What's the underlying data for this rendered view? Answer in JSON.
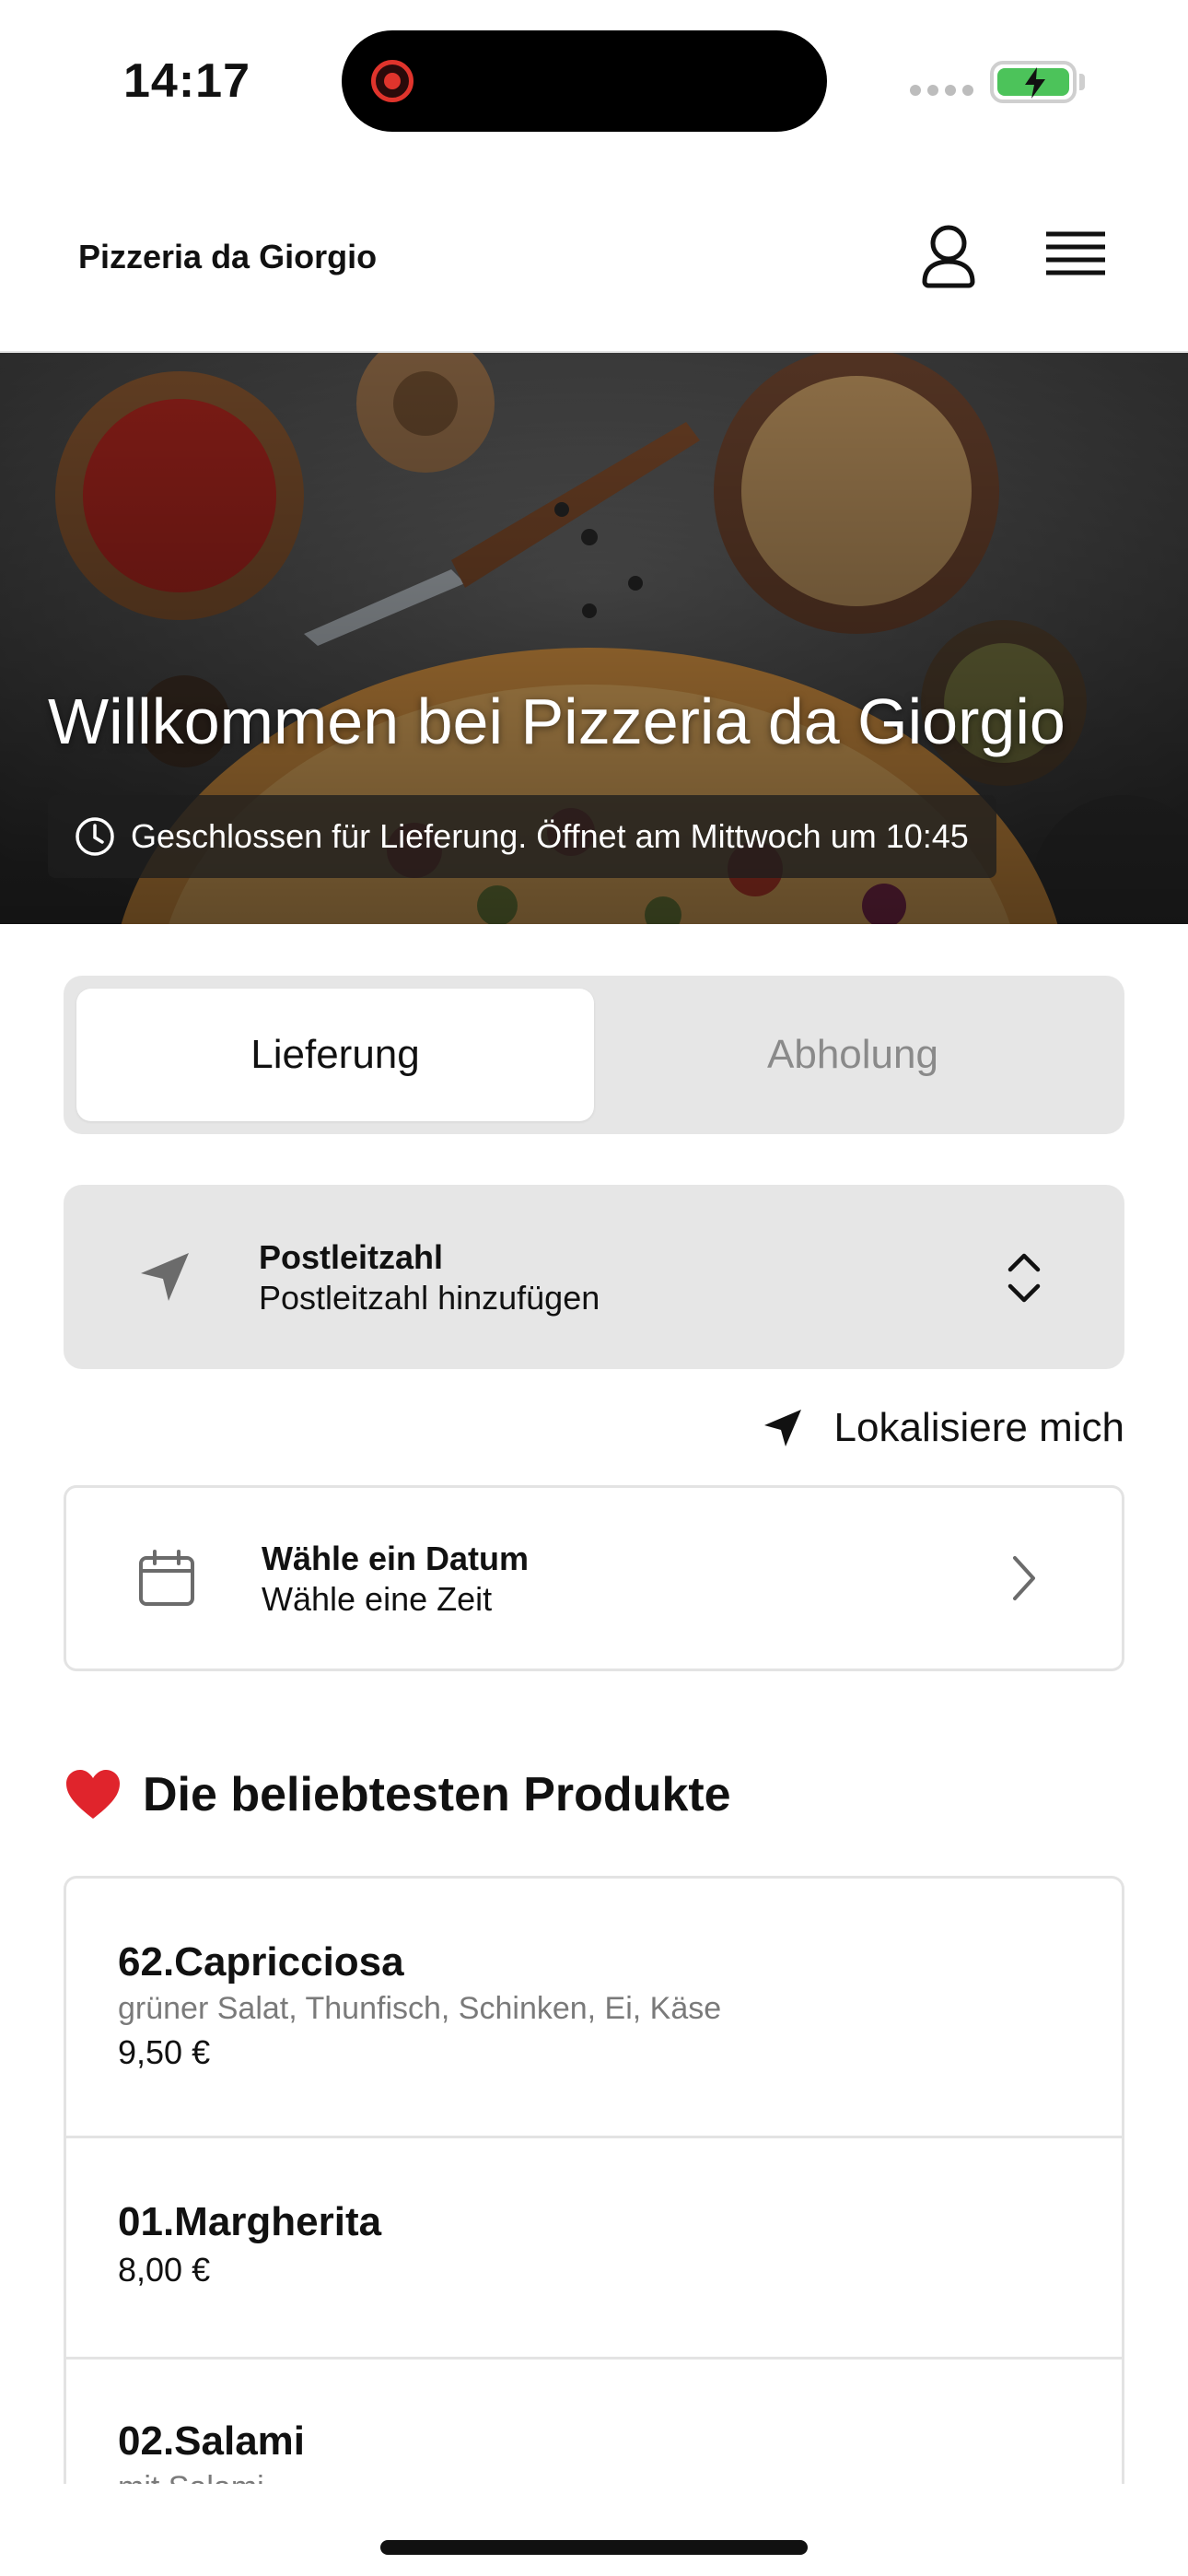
{
  "status_bar": {
    "time": "14:17",
    "battery_color": "#4cc35a",
    "record_color": "#e0342c"
  },
  "header": {
    "brand": "Pizzeria da Giorgio",
    "user_icon": "user-icon",
    "menu_icon": "hamburger-menu-icon"
  },
  "hero": {
    "title": "Willkommen bei Pizzeria da Giorgio",
    "status_icon": "clock-icon",
    "status_text": "Geschlossen für Lieferung. Öffnet am Mittwoch um 10:45"
  },
  "order_mode": {
    "tabs": [
      {
        "label": "Lieferung",
        "active": true
      },
      {
        "label": "Abholung",
        "active": false
      }
    ]
  },
  "postcode": {
    "icon": "navigation-arrow-icon",
    "title": "Postleitzahl",
    "placeholder": "Postleitzahl hinzufügen"
  },
  "locate": {
    "icon": "location-arrow-icon",
    "label": "Lokalisiere mich"
  },
  "date_picker": {
    "icon": "calendar-icon",
    "title": "Wähle ein Datum",
    "subtitle": "Wähle eine Zeit"
  },
  "popular": {
    "icon": "red-heart-icon",
    "title": "Die beliebtesten Produkte",
    "items": [
      {
        "name": "62.Capricciosa",
        "description": "grüner Salat, Thunfisch, Schinken, Ei, Käse",
        "price": "9,50 €"
      },
      {
        "name": "01.Margherita",
        "description": "",
        "price": "8,00 €"
      },
      {
        "name": "02.Salami",
        "description": "mit Salami",
        "price": ""
      }
    ]
  }
}
